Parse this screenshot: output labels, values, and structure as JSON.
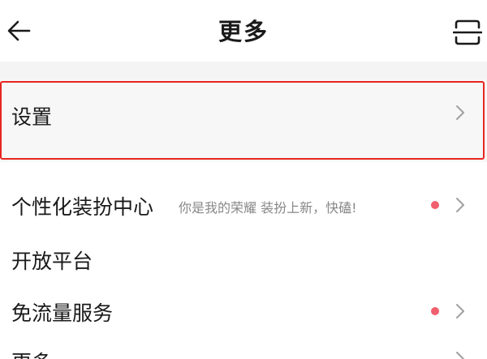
{
  "header": {
    "title": "更多",
    "back_icon": "arrow-left-icon",
    "scan_icon": "scan-icon"
  },
  "settings": {
    "label": "设置",
    "chevron_icon": "chevron-right-icon"
  },
  "menu": [
    {
      "label": "个性化装扮中心",
      "tagline": "你是我的荣耀 装扮上新，快磕!",
      "has_dot": true,
      "chevron": true
    },
    {
      "label": "开放平台",
      "has_dot": false,
      "chevron": false
    },
    {
      "label": "免流量服务",
      "has_dot": true,
      "chevron": true
    },
    {
      "label": "更多",
      "has_dot": false,
      "chevron": true
    }
  ],
  "colors": {
    "highlight_border": "#e8251f",
    "dot": "#f0606e",
    "tagline": "#888888",
    "section_bg": "#f4f4f4"
  }
}
